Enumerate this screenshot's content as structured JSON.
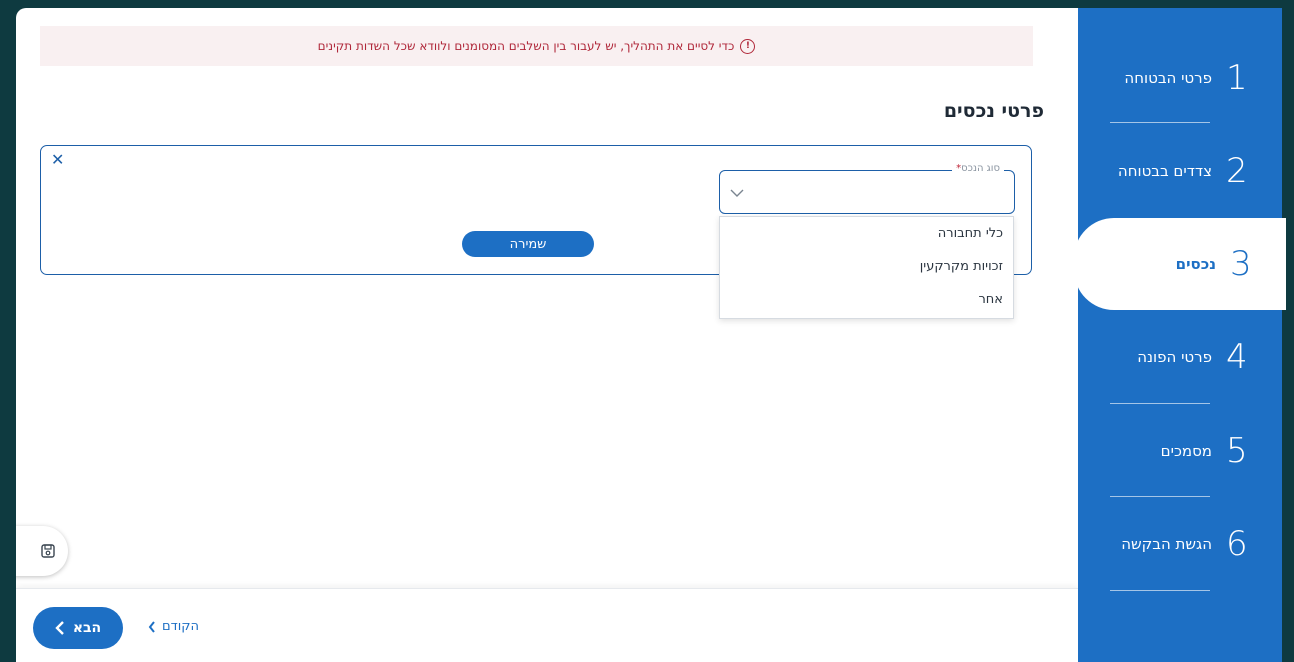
{
  "alert": {
    "text": "כדי לסיים את התהליך, יש לעבור בין השלבים המסומנים ולוודא שכל השדות תקינים",
    "icon": "info-circle-icon"
  },
  "section": {
    "title": "פרטי נכסים"
  },
  "asset_form": {
    "asset_type_label": "סוג הנכס",
    "required_mark": "*",
    "asset_type_value": "",
    "save_label": "שמירה",
    "options": [
      "כלי תחבורה",
      "זכויות מקרקעין",
      "אחר"
    ]
  },
  "footer": {
    "next_label": "הבא",
    "prev_label": "הקודם"
  },
  "steps": [
    {
      "num": "1",
      "label": "פרטי הבטוחה"
    },
    {
      "num": "2",
      "label": "צדדים בבטוחה"
    },
    {
      "num": "3",
      "label": "נכסים"
    },
    {
      "num": "4",
      "label": "פרטי הפונה"
    },
    {
      "num": "5",
      "label": "מסמכים"
    },
    {
      "num": "6",
      "label": "הגשת הבקשה"
    }
  ],
  "active_step": "3",
  "colors": {
    "primary": "#1d6fc4",
    "background": "#0e3a40",
    "alert_text": "#b0283a",
    "alert_bg": "#f9f0f1"
  }
}
